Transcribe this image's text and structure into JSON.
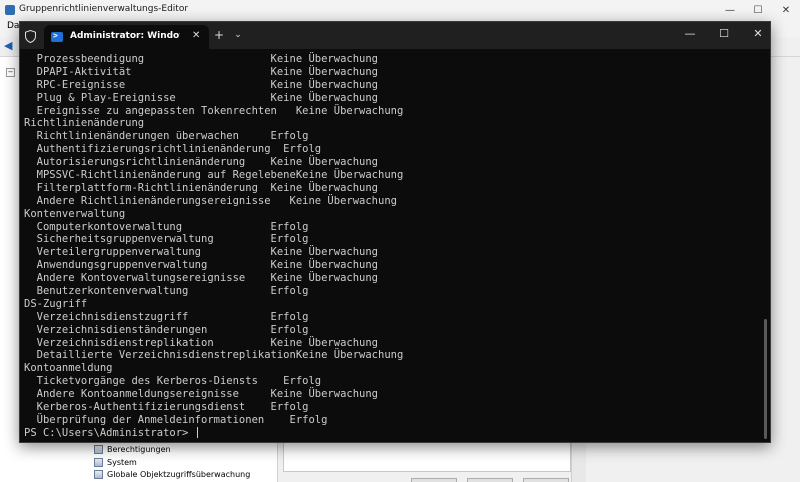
{
  "background_window": {
    "title": "Gruppenrichtlinienverwaltungs-Editor",
    "menu_first_item": "Da",
    "window_controls": {
      "minimize": "—",
      "maximize": "☐",
      "close": "✕"
    },
    "tree_items": [
      "Berechtigungen",
      "System",
      "Globale Objektzugriffsüberwachung"
    ]
  },
  "terminal": {
    "tab_title": "Administrator: Windows PowerShell",
    "tab_close": "✕",
    "new_tab": "+",
    "dropdown": "⌄",
    "window_controls": {
      "minimize": "—",
      "maximize": "☐",
      "close": "✕"
    },
    "lines": [
      "  Prozessbeendigung                    Keine Überwachung",
      "  DPAPI-Aktivität                      Keine Überwachung",
      "  RPC-Ereignisse                       Keine Überwachung",
      "  Plug & Play-Ereignisse               Keine Überwachung",
      "  Ereignisse zu angepassten Tokenrechten   Keine Überwachung",
      "Richtlinienänderung",
      "  Richtlinienänderungen überwachen     Erfolg",
      "  Authentifizierungsrichtlinienänderung  Erfolg",
      "  Autorisierungsrichtlinienänderung    Keine Überwachung",
      "  MPSSVC-Richtlinienänderung auf RegelebeneKeine Überwachung",
      "  Filterplattform-Richtlinienänderung  Keine Überwachung",
      "  Andere Richtlinienänderungsereignisse   Keine Überwachung",
      "Kontenverwaltung",
      "  Computerkontoverwaltung              Erfolg",
      "  Sicherheitsgruppenverwaltung         Erfolg",
      "  Verteilergruppenverwaltung           Keine Überwachung",
      "  Anwendungsgruppenverwaltung          Keine Überwachung",
      "  Andere Kontoverwaltungsereignisse    Keine Überwachung",
      "  Benutzerkontenverwaltung             Erfolg",
      "DS-Zugriff",
      "  Verzeichnisdienstzugriff             Erfolg",
      "  Verzeichnisdienständerungen          Erfolg",
      "  Verzeichnisdienstreplikation         Keine Überwachung",
      "  Detaillierte VerzeichnisdienstreplikationKeine Überwachung",
      "Kontoanmeldung",
      "  Ticketvorgänge des Kerberos-Diensts    Erfolg",
      "  Andere Kontoanmeldungsereignisse     Keine Überwachung",
      "  Kerberos-Authentifizierungsdienst    Erfolg",
      "  Überprüfung der Anmeldeinformationen    Erfolg"
    ],
    "prompt": "PS C:\\Users\\Administrator> "
  }
}
